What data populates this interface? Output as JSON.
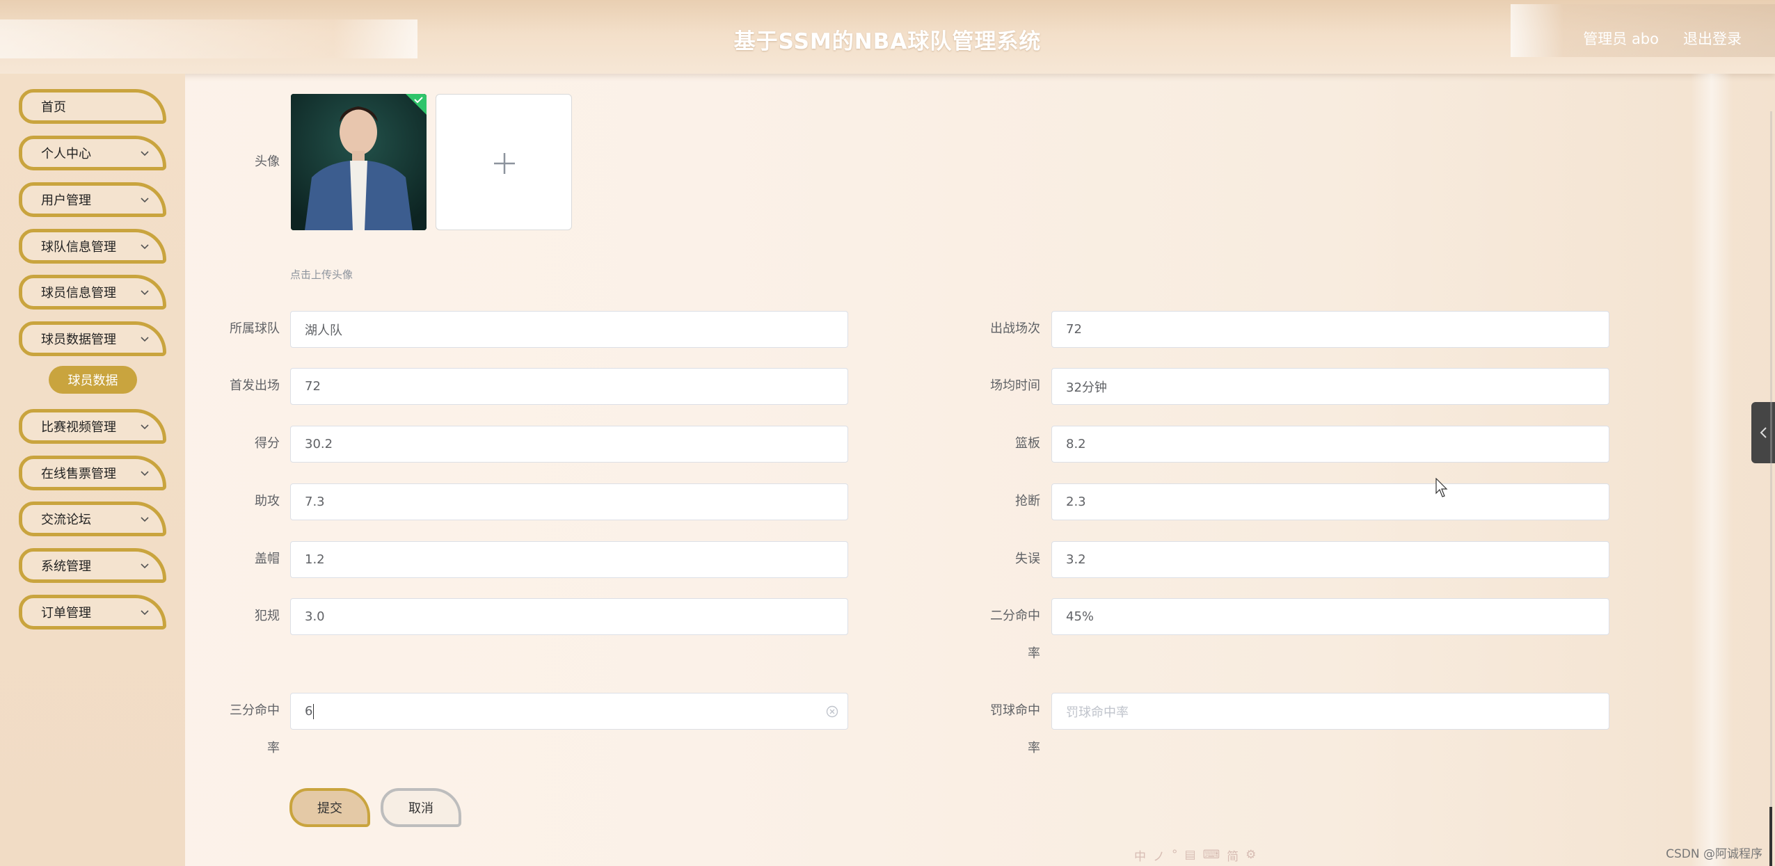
{
  "header": {
    "title": "基于SSM的NBA球队管理系统",
    "user_label": "管理员 abo",
    "logout_label": "退出登录"
  },
  "sidebar": {
    "items": [
      {
        "label": "首页",
        "icon": "none"
      },
      {
        "label": "个人中心",
        "icon": "chevron-down-icon"
      },
      {
        "label": "用户管理",
        "icon": "chevron-down-icon"
      },
      {
        "label": "球队信息管理",
        "icon": "chevron-down-icon"
      },
      {
        "label": "球员信息管理",
        "icon": "chevron-down-icon"
      },
      {
        "label": "球员数据管理",
        "icon": "chevron-down-icon"
      },
      {
        "label": "比赛视频管理",
        "icon": "chevron-down-icon"
      },
      {
        "label": "在线售票管理",
        "icon": "chevron-down-icon"
      },
      {
        "label": "交流论坛",
        "icon": "chevron-down-icon"
      },
      {
        "label": "系统管理",
        "icon": "chevron-down-icon"
      },
      {
        "label": "订单管理",
        "icon": "chevron-down-icon"
      }
    ],
    "active_sub": "球员数据",
    "accent": "#c9a43e"
  },
  "form": {
    "avatar_label": "头像",
    "upload_tip": "点击上传头像",
    "team": {
      "label": "所属球队",
      "value": "湖人队"
    },
    "games": {
      "label": "出战场次",
      "value": "72"
    },
    "starts": {
      "label": "首发出场",
      "value": "72"
    },
    "minutes": {
      "label": "场均时间",
      "value": "32分钟"
    },
    "points": {
      "label": "得分",
      "value": "30.2"
    },
    "rebounds": {
      "label": "篮板",
      "value": "8.2"
    },
    "assists": {
      "label": "助攻",
      "value": "7.3"
    },
    "steals": {
      "label": "抢断",
      "value": "2.3"
    },
    "blocks": {
      "label": "盖帽",
      "value": "1.2"
    },
    "turnovers": {
      "label": "失误",
      "value": "3.2"
    },
    "fouls": {
      "label": "犯规",
      "value": "3.0"
    },
    "two_pct": {
      "label_line1": "二分命中",
      "label_line2": "率",
      "value": "45%"
    },
    "three_pct": {
      "label_line1": "三分命中",
      "label_line2": "率",
      "value": "6"
    },
    "ft_pct": {
      "label_line1": "罚球命中",
      "label_line2": "率",
      "placeholder": "罚球命中率"
    },
    "submit_label": "提交",
    "cancel_label": "取消"
  },
  "ime_toolbar": [
    "中",
    "ノ",
    "°",
    "▤",
    "⌨",
    "简",
    "⚙"
  ],
  "watermark": "CSDN @阿诚程序"
}
